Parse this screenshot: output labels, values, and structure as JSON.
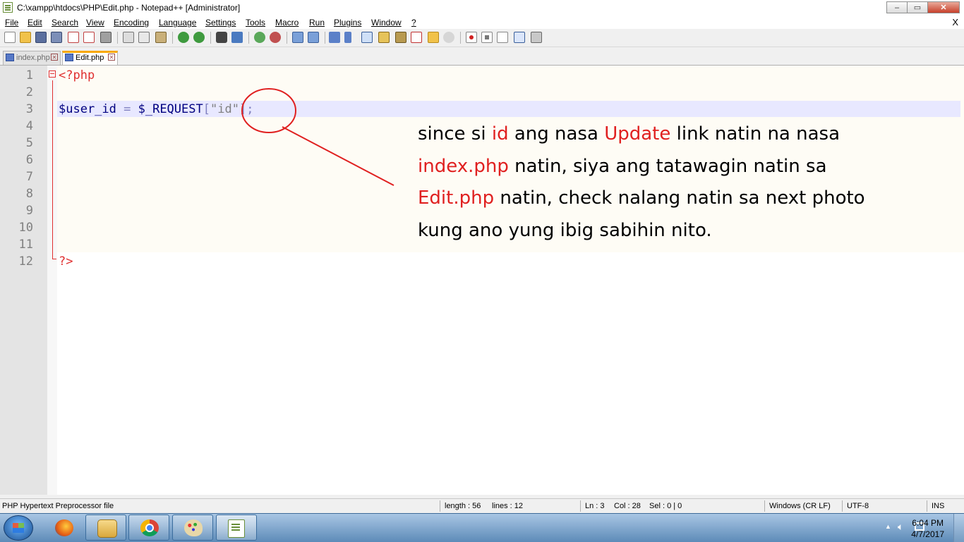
{
  "window": {
    "title": "C:\\xampp\\htdocs\\PHP\\Edit.php - Notepad++ [Administrator]",
    "controls": {
      "minimize": "–",
      "maximize": "▭",
      "close": "✕"
    }
  },
  "menu": {
    "items": [
      "File",
      "Edit",
      "Search",
      "View",
      "Encoding",
      "Language",
      "Settings",
      "Tools",
      "Macro",
      "Run",
      "Plugins",
      "Window",
      "?"
    ],
    "close_label": "X"
  },
  "tabs": [
    {
      "label": "index.php",
      "active": false
    },
    {
      "label": "Edit.php",
      "active": true
    }
  ],
  "editor": {
    "line_numbers": [
      "1",
      "2",
      "3",
      "4",
      "5",
      "6",
      "7",
      "8",
      "9",
      "10",
      "11",
      "12"
    ],
    "current_line": 3,
    "code": {
      "line1": "<?php",
      "line3_var": "$user_id",
      "line3_op": " = ",
      "line3_req": "$_REQUEST",
      "line3_open": "[",
      "line3_str": "\"id\"",
      "line3_close": "]",
      "line3_semi": ";",
      "line12": "?>"
    }
  },
  "annotation": {
    "p1": "since si ",
    "h1": "id",
    "p2": " ang nasa ",
    "h2": "Update",
    "p3": " link natin na nasa ",
    "h3": "index.php",
    "p4": " natin, siya ang tatawagin natin sa ",
    "h4": "Edit.php",
    "p5": " natin, check nalang natin sa next photo kung ano yung ibig sabihin nito.",
    "color": "#e02020"
  },
  "statusbar": {
    "file_type": "PHP Hypertext Preprocessor file",
    "length": "length : 56",
    "lines": "lines : 12",
    "ln": "Ln : 3",
    "col": "Col : 28",
    "sel": "Sel : 0 | 0",
    "eol": "Windows (CR LF)",
    "encoding": "UTF-8",
    "mode": "INS"
  },
  "taskbar": {
    "apps": [
      "firefox-icon",
      "file-explorer-icon",
      "chrome-icon",
      "paint-icon",
      "notepadpp-icon"
    ],
    "time": "6:04 PM",
    "date": "4/7/2017"
  },
  "colors": {
    "keyword_red": "#e03030",
    "variable_blue": "#000080",
    "string_gray": "#808080",
    "current_line": "#e8e8ff"
  }
}
